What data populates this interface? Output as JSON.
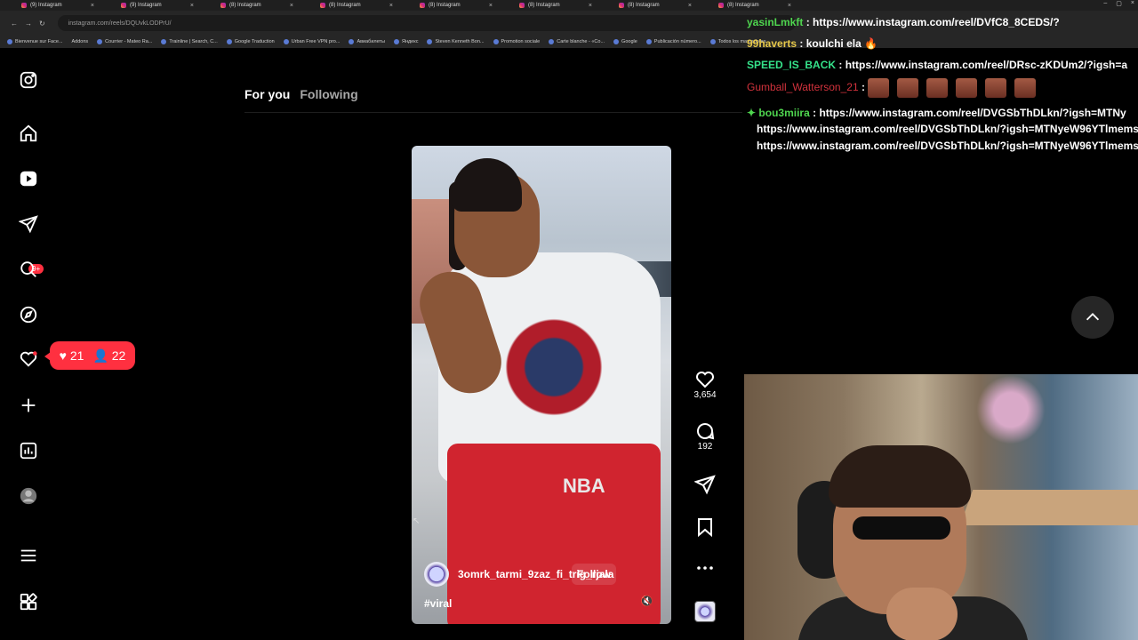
{
  "browser": {
    "tabs": [
      {
        "title": "(9) Instagram"
      },
      {
        "title": "(9) Instagram"
      },
      {
        "title": "(8) Instagram"
      },
      {
        "title": "(8) Instagram"
      },
      {
        "title": "(8) Instagram"
      },
      {
        "title": "(8) Instagram"
      },
      {
        "title": "(8) Instagram"
      },
      {
        "title": "(8) Instagram"
      }
    ],
    "url": "instagram.com/reels/DQUvkLODPrU/",
    "bookmarks": [
      "Bienvenue sur Face...",
      "Addons",
      "Courrier - Mateo Ra...",
      "Trainline | Search, C...",
      "Google Traduction",
      "Urban Free VPN pro...",
      "Авиабилеты",
      "Яндекс",
      "Steven Kenneth Bon...",
      "Promotion sociale",
      "Carte blanche - «Co...",
      "Google",
      "Publicación número...",
      "Todos los marcadores"
    ]
  },
  "sidebar": {
    "messages_badge": "9+",
    "notification": {
      "likes": "21",
      "follows": "22"
    }
  },
  "feed": {
    "tabs": [
      {
        "label": "For you"
      },
      {
        "label": "Following"
      }
    ]
  },
  "reel": {
    "username": "3omrk_tarmi_9zaz_fi_trig_rjala",
    "follow_label": "Follow",
    "hashtag": "#viral",
    "likes": "3,654",
    "comments": "192",
    "shirt_text": "NBA"
  },
  "chat": [
    {
      "user": "yasinLmkft",
      "user_color": "#4fd64f",
      "text": "https://www.instagram.com/reel/DVfC8_8CEDS/?"
    },
    {
      "user": "99haverts",
      "user_color": "#e6c84a",
      "text": "koulchi ela"
    },
    {
      "user": "SPEED_IS_BACK",
      "user_color": "#35e28a",
      "text": "https://www.instagram.com/reel/DRsc-zKDUm2/?igsh=a"
    },
    {
      "user": "Gumball_Watterson_21",
      "user_color": "#d2323c",
      "text": ""
    },
    {
      "user": "bou3miira",
      "user_color": "#4fd64f",
      "text": "https://www.instagram.com/reel/DVGSbThDLkn/?igsh=MTNy"
    },
    {
      "user": "",
      "user_color": "#ffffff",
      "text": "https://www.instagram.com/reel/DVGSbThDLkn/?igsh=MTNyeW96YTlmems"
    },
    {
      "user": "",
      "user_color": "#ffffff",
      "text": "https://www.instagram.com/reel/DVGSbThDLkn/?igsh=MTNyeW96YTlmems"
    }
  ],
  "colors": {
    "accent": "#ff3040",
    "background": "#000000"
  }
}
